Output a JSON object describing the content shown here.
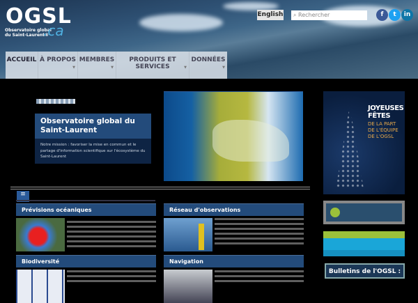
{
  "header": {
    "logo": "OGSL",
    "logo_sub1": "Observatoire global",
    "logo_sub2": "du Saint-Laurent®",
    "logo_ca": ".ca",
    "lang_button": "English",
    "search_placeholder": "Rechercher",
    "social": [
      "f",
      "t",
      "in"
    ]
  },
  "nav": [
    "ACCUEIL",
    "À PROPOS",
    "MEMBRES",
    "PRODUITS ET SERVICES",
    "DONNÉES"
  ],
  "slider": {
    "title": "Observatoire global du Saint-Laurent",
    "text": "Notre mission : favoriser la mise en commun et le partage d'information scientifique sur l'écosystème du Saint-Laurent"
  },
  "sections": [
    "Prévisions océaniques",
    "Réseau d'observations",
    "Biodiversité",
    "Navigation"
  ],
  "sidebar": {
    "banner_title": "JOYEUSES FÊTES",
    "banner_sub": "DE LA PART DE L'ÉQUIPE DE L'OGSL",
    "bulletins": "Bulletins de l'OGSL :"
  },
  "colors": {
    "section": "#234b7b",
    "accent": "#4fb0e0"
  }
}
